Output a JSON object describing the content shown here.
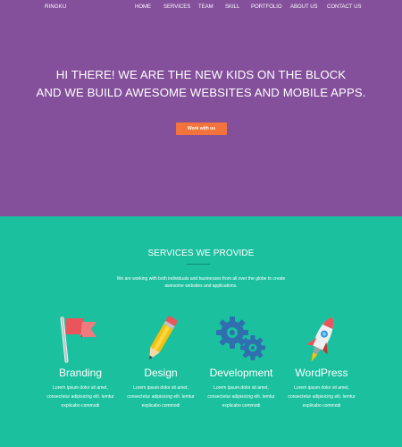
{
  "brand": "RINGKU",
  "nav": {
    "items": [
      "HOME",
      "SERVICES",
      "TEAM",
      "SKILL",
      "PORTFOLIO",
      "ABOUT US",
      "CONTACT US"
    ]
  },
  "hero": {
    "line1": "HI THERE! WE ARE THE NEW KIDS ON THE BLOCK",
    "line2": "AND WE BUILD AWESOME WEBSITES AND MOBILE APPS.",
    "cta_label": "Work with us"
  },
  "services": {
    "title": "SERVICES WE PROVIDE",
    "intro": "We are working with both individuals and businesses from all over the globe to create awesome websites and applications.",
    "items": [
      {
        "title": "Branding",
        "icon": "flag-icon",
        "desc": "Lorem ipsum dolor sit amet, consectetur adipisicing elit. Iemtur explicabo commodi"
      },
      {
        "title": "Design",
        "icon": "pencil-icon",
        "desc": "Lorem ipsum dolor sit amet, consectetur adipisicing elit. Iemtur explicabo commodi"
      },
      {
        "title": "Development",
        "icon": "gears-icon",
        "desc": "Lorem ipsum dolor sit amet, consectetur adipisicing elit. Iemtur explicabo commodi"
      },
      {
        "title": "WordPress",
        "icon": "rocket-icon",
        "desc": "Lorem ipsum dolor sit amet, consectetur adipisicing elit. Iemtur explicabo commodi"
      }
    ]
  },
  "colors": {
    "hero_bg": "#844f9b",
    "services_bg": "#1bc09f",
    "cta_bg": "#f2733c"
  }
}
